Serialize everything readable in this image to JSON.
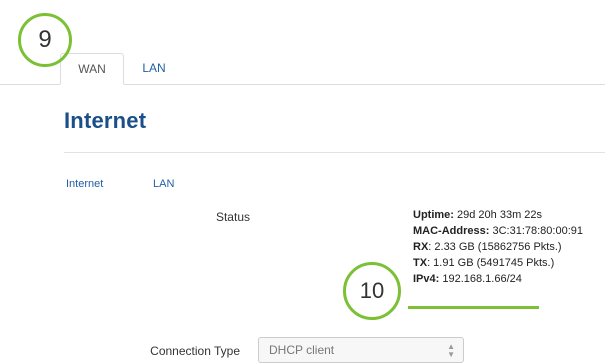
{
  "tabs": [
    {
      "label": "WAN",
      "active": true
    },
    {
      "label": "LAN",
      "active": false
    }
  ],
  "page": {
    "title": "Internet"
  },
  "subtabs": [
    {
      "label": "Internet"
    },
    {
      "label": "LAN"
    }
  ],
  "status": {
    "label": "Status",
    "rows": [
      {
        "key": "Uptime:",
        "value": " 29d 20h 33m 22s"
      },
      {
        "key": "MAC-Address:",
        "value": " 3C:31:78:80:00:91"
      },
      {
        "key": "RX",
        "value": ": 2.33 GB (15862756 Pkts.)"
      },
      {
        "key": "TX",
        "value": ": 1.91 GB (5491745 Pkts.)"
      },
      {
        "key": "IPv4:",
        "value": " 192.168.1.66/24"
      }
    ]
  },
  "connection": {
    "label": "Connection Type",
    "value": "DHCP client"
  },
  "callouts": {
    "first": "9",
    "second": "10"
  },
  "colors": {
    "callout_green": "#7cc035",
    "link_blue": "#1f5fa8",
    "title_blue": "#1a4f8a"
  },
  "icons": {
    "select_arrows": "updown-chevron-icon"
  }
}
